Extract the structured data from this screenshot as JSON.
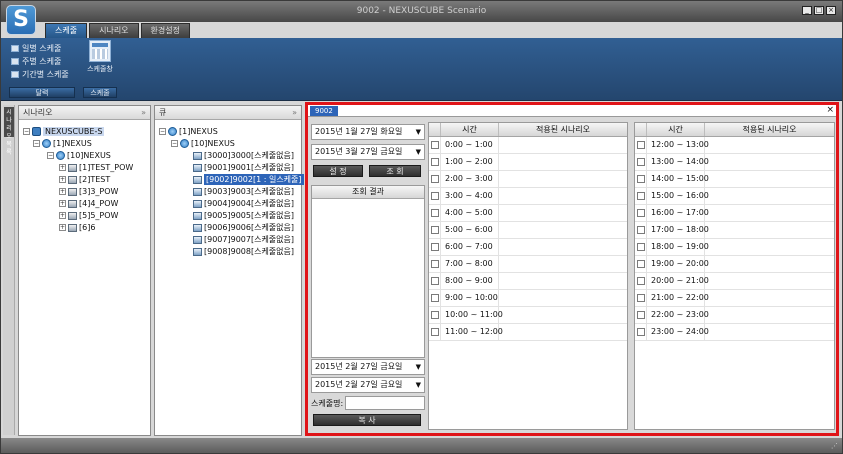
{
  "window": {
    "title": "9002 - NEXUSCUBE Scenario",
    "controls": [
      "_",
      "□",
      "×"
    ]
  },
  "tabs": [
    {
      "label": "스케줄",
      "active": true
    },
    {
      "label": "시나리오",
      "active": false
    },
    {
      "label": "환경설정",
      "active": false
    }
  ],
  "ribbon": {
    "list": [
      "일별 스케줄",
      "주별 스케줄",
      "기간별 스케줄"
    ],
    "big_label": "스케줄창",
    "group_calendar": "달력",
    "group_schedule": "스케줄"
  },
  "vstrip": {
    "label": "시나리오목록"
  },
  "scenario_panel": {
    "title": "시나리오",
    "root": "NEXUSCUBE-S",
    "nodes": [
      "[1]NEXUS",
      "[10]NEXUS",
      "[1]TEST_POW",
      "[2]TEST",
      "[3]3_POW",
      "[4]4_POW",
      "[5]5_POW",
      "[6]6"
    ]
  },
  "queue_panel": {
    "title": "큐",
    "nodes": [
      "[1]NEXUS",
      "[10]NEXUS"
    ],
    "items": [
      "[3000]3000[스케줄없음]",
      "[9001]9001[스케줄없음]",
      "[9002]9002[1 : 일스케줄]",
      "[9003]9003[스케줄없음]",
      "[9004]9004[스케줄없음]",
      "[9005]9005[스케줄없음]",
      "[9006]9006[스케줄없음]",
      "[9007]9007[스케줄없음]",
      "[9008]9008[스케줄없음]"
    ]
  },
  "main": {
    "tab_label": "9002",
    "close": "×",
    "date_from": "2015년  1월 27일 화요일",
    "date_to": "2015년  3월 27일 금요일",
    "btn_set": "설 정",
    "btn_query": "조 회",
    "results_header": "조회 결과",
    "copy_from": "2015년  2월 27일 금요일",
    "copy_to": "2015년  2월 27일 금요일",
    "schedule_name_label": "스케줄명:",
    "btn_copy": "복 사",
    "col_time": "시간",
    "col_scenario": "적용된 시나리오",
    "am_rows": [
      "0:00 ~ 1:00",
      "1:00 ~ 2:00",
      "2:00 ~ 3:00",
      "3:00 ~ 4:00",
      "4:00 ~ 5:00",
      "5:00 ~ 6:00",
      "6:00 ~ 7:00",
      "7:00 ~ 8:00",
      "8:00 ~ 9:00",
      "9:00 ~ 10:00",
      "10:00 ~ 11:00",
      "11:00 ~ 12:00"
    ],
    "pm_rows": [
      "12:00 ~ 13:00",
      "13:00 ~ 14:00",
      "14:00 ~ 15:00",
      "15:00 ~ 16:00",
      "16:00 ~ 17:00",
      "17:00 ~ 18:00",
      "18:00 ~ 19:00",
      "19:00 ~ 20:00",
      "20:00 ~ 21:00",
      "21:00 ~ 22:00",
      "22:00 ~ 23:00",
      "23:00 ~ 24:00"
    ]
  }
}
